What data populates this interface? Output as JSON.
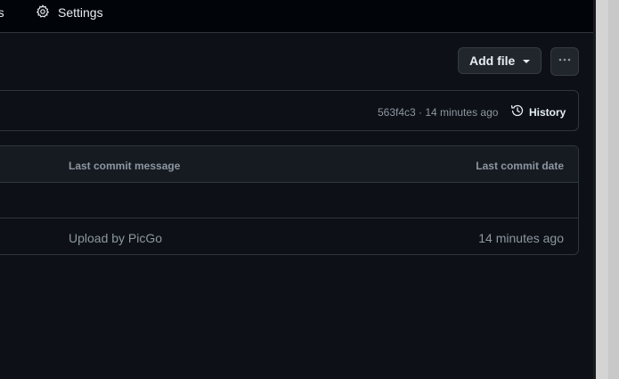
{
  "nav": {
    "partial_label": "nts",
    "settings_label": "Settings",
    "settings_icon": "gear-icon"
  },
  "toolbar": {
    "add_file_label": "Add file",
    "more_icon": "kebab-horizontal-icon"
  },
  "commit": {
    "meta": "563f4c3 · 14 minutes ago",
    "history_label": "History",
    "history_icon": "history-icon"
  },
  "table": {
    "headers": {
      "message": "Last commit message",
      "date": "Last commit date"
    },
    "rows": [
      {
        "message": "",
        "date": ""
      },
      {
        "message": "Upload by PicGo",
        "date": "14 minutes ago"
      }
    ]
  },
  "colors": {
    "background": "#0d1117",
    "border": "#30363d",
    "muted_text": "#8d96a0",
    "primary_text": "#e6edf3",
    "button_bg": "#21262d"
  }
}
